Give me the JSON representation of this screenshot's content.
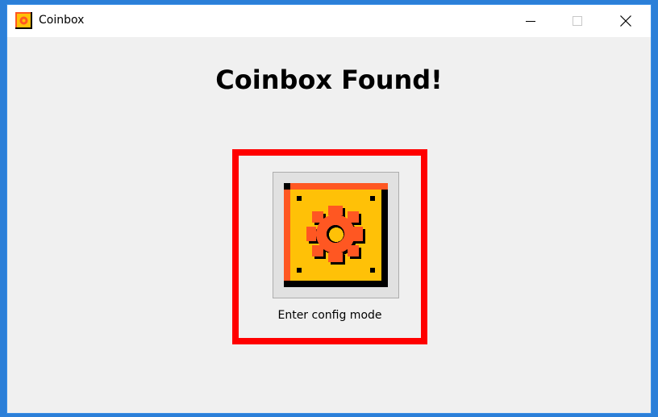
{
  "window": {
    "title": "Coinbox",
    "icon": "coinbox-app-icon",
    "controls": {
      "minimize": "minimize-icon",
      "maximize": "maximize-icon",
      "close": "close-icon"
    }
  },
  "main": {
    "heading": "Coinbox Found!",
    "config_button": {
      "label": "Enter config mode",
      "icon": "gear-box-icon"
    }
  },
  "colors": {
    "highlight": "#ff0000",
    "box_yellow": "#ffc107",
    "box_orange": "#ff5722",
    "box_dark": "#000000"
  }
}
